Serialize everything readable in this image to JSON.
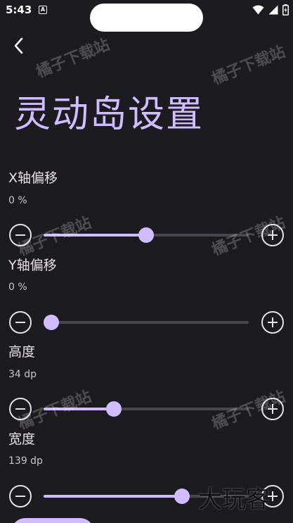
{
  "status_bar": {
    "time": "5:43",
    "notification_glyph": "A",
    "icons": [
      "wifi-icon",
      "signal-icon",
      "battery-charging-icon"
    ]
  },
  "header": {
    "back_icon": "chevron-left-icon",
    "title": "灵动岛设置"
  },
  "settings": [
    {
      "id": "x-offset",
      "label": "X轴偏移",
      "value": "0 %",
      "level": 0.5
    },
    {
      "id": "y-offset",
      "label": "Y轴偏移",
      "value": "0 %",
      "level": 0.0
    },
    {
      "id": "height",
      "label": "高度",
      "value": "34 dp",
      "level": 0.33
    },
    {
      "id": "width",
      "label": "宽度",
      "value": "139 dp",
      "level": 0.69
    }
  ],
  "stepper": {
    "decrease_icon": "minus-circle-icon",
    "increase_icon": "plus-circle-icon"
  },
  "watermark": "橘子下载站",
  "corner_logo": "大玩客",
  "colors": {
    "background": "#1c1b1f",
    "accent": "#d0bcff",
    "track": "#49454f",
    "text": "#e6e1e5"
  }
}
